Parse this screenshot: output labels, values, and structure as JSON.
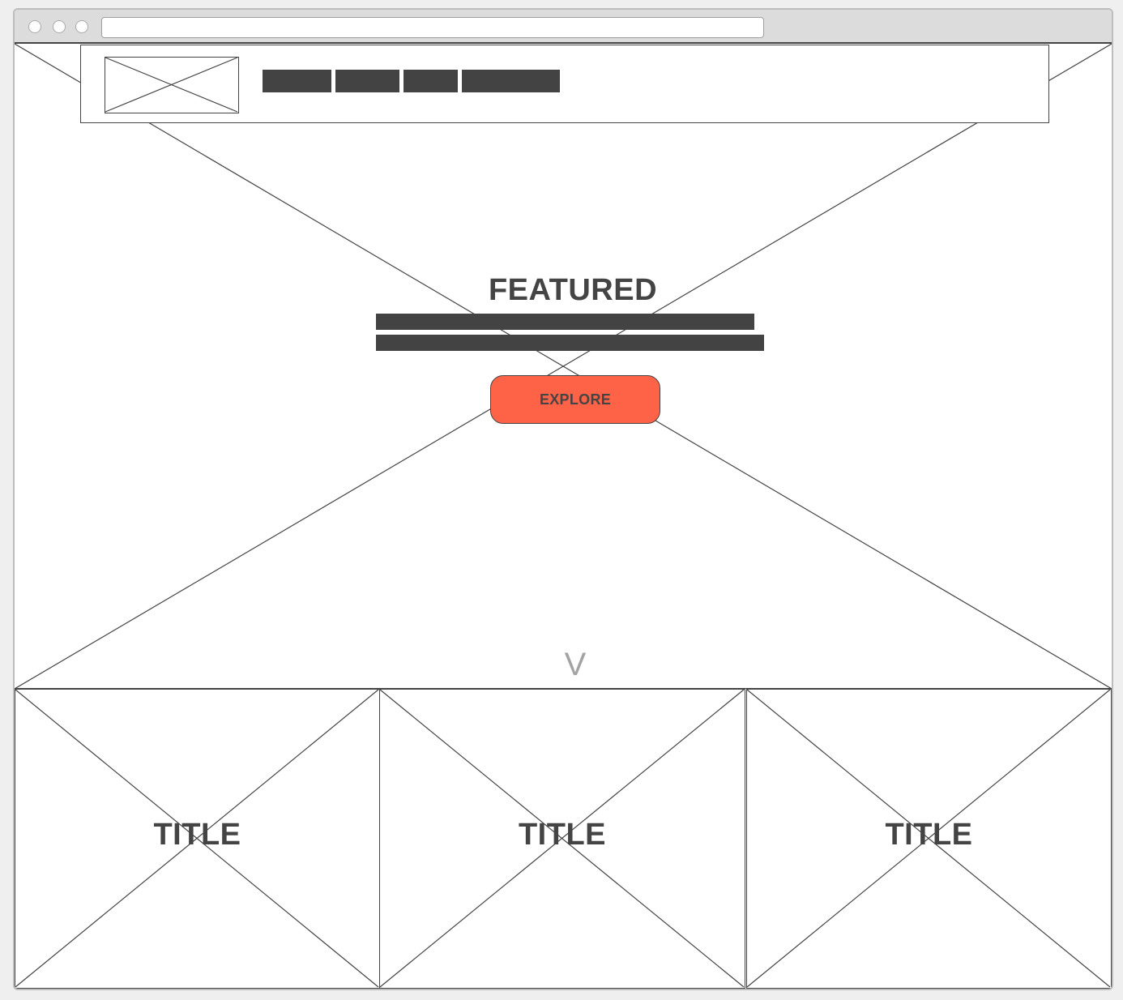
{
  "browser": {
    "window_buttons": [
      "close-button",
      "minimize-button",
      "zoom-button"
    ],
    "address": ""
  },
  "nav": {
    "items": [
      "",
      "",
      "",
      ""
    ]
  },
  "hero": {
    "title": "FEATURED",
    "description_lines": [
      "",
      ""
    ],
    "cta_label": "EXPLORE",
    "scroll_indicator": "V"
  },
  "cards": [
    {
      "title": "TITLE"
    },
    {
      "title": "TITLE"
    },
    {
      "title": "TITLE"
    }
  ],
  "colors": {
    "accent": "#ff6347",
    "ink": "#444444",
    "placeholder_text": "#a3a3a3",
    "chrome": "#dcdcdc"
  }
}
